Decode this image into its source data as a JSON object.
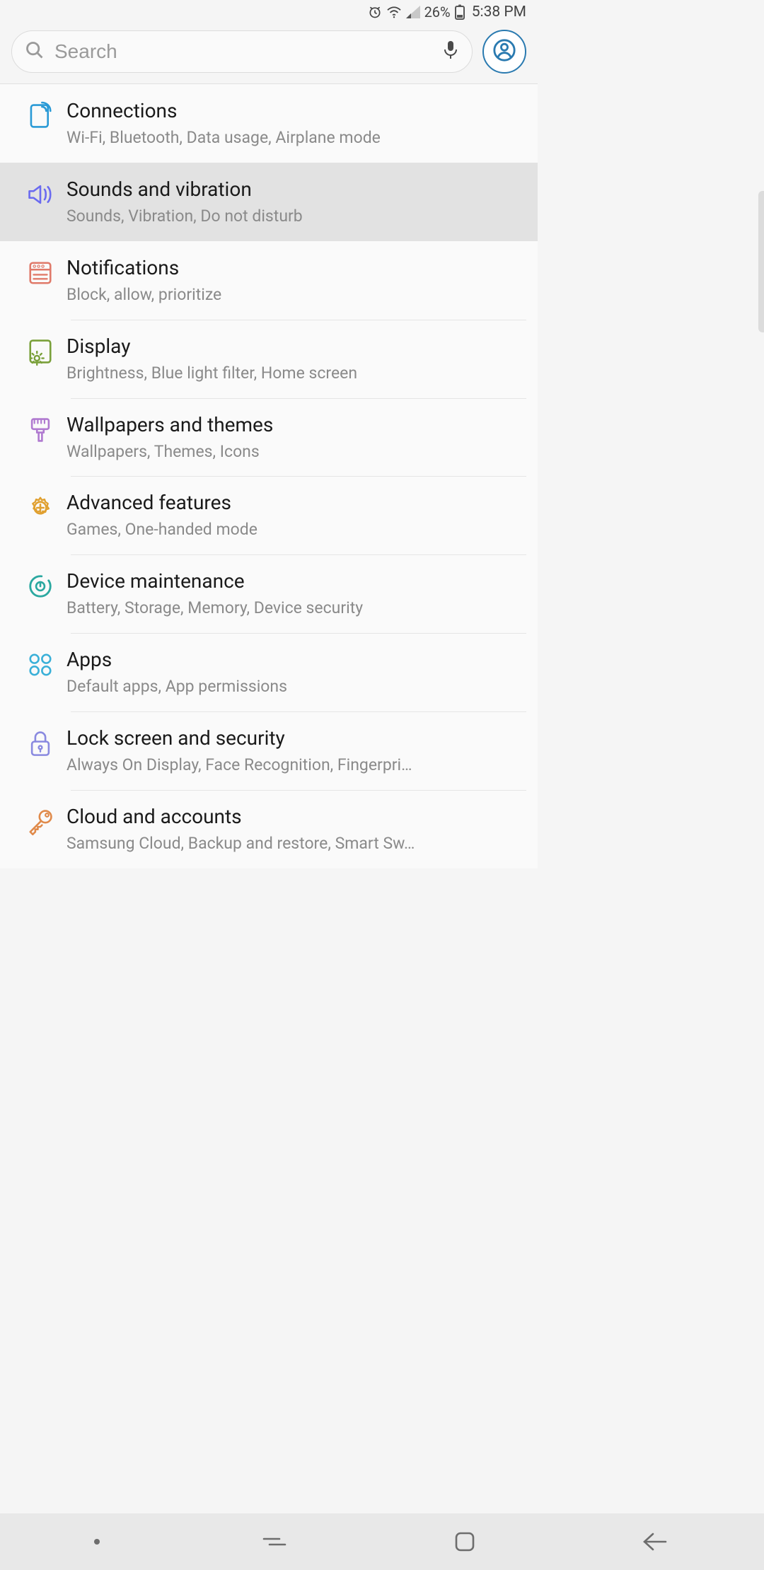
{
  "status": {
    "battery_pct": "26%",
    "time": "5:38 PM"
  },
  "search": {
    "placeholder": "Search"
  },
  "settings": [
    {
      "key": "connections",
      "title": "Connections",
      "subtitle": "Wi-Fi, Bluetooth, Data usage, Airplane mode",
      "highlight": false,
      "icon": "sim-icon",
      "color": "#2a9ad6"
    },
    {
      "key": "sounds",
      "title": "Sounds and vibration",
      "subtitle": "Sounds, Vibration, Do not disturb",
      "highlight": true,
      "icon": "speaker-icon",
      "color": "#6a6af0"
    },
    {
      "key": "notifications",
      "title": "Notifications",
      "subtitle": "Block, allow, prioritize",
      "highlight": false,
      "icon": "notification-panel-icon",
      "color": "#e07a6a"
    },
    {
      "key": "display",
      "title": "Display",
      "subtitle": "Brightness, Blue light filter, Home screen",
      "highlight": false,
      "icon": "display-sun-icon",
      "color": "#7aa03a"
    },
    {
      "key": "wallpapers",
      "title": "Wallpapers and themes",
      "subtitle": "Wallpapers, Themes, Icons",
      "highlight": false,
      "icon": "paintbrush-icon",
      "color": "#b07ad0"
    },
    {
      "key": "advanced",
      "title": "Advanced features",
      "subtitle": "Games, One-handed mode",
      "highlight": false,
      "icon": "gear-plus-icon",
      "color": "#e0a030"
    },
    {
      "key": "device_maintenance",
      "title": "Device maintenance",
      "subtitle": "Battery, Storage, Memory, Device security",
      "highlight": false,
      "icon": "cycle-icon",
      "color": "#2aa8a0"
    },
    {
      "key": "apps",
      "title": "Apps",
      "subtitle": "Default apps, App permissions",
      "highlight": false,
      "icon": "apps-grid-icon",
      "color": "#3ab0d8"
    },
    {
      "key": "lock",
      "title": "Lock screen and security",
      "subtitle": "Always On Display, Face Recognition, Fingerpri…",
      "highlight": false,
      "icon": "lock-icon",
      "color": "#8a8ae0"
    },
    {
      "key": "cloud",
      "title": "Cloud and accounts",
      "subtitle": "Samsung Cloud, Backup and restore, Smart Sw…",
      "highlight": false,
      "icon": "key-icon",
      "color": "#e08a4a"
    }
  ]
}
